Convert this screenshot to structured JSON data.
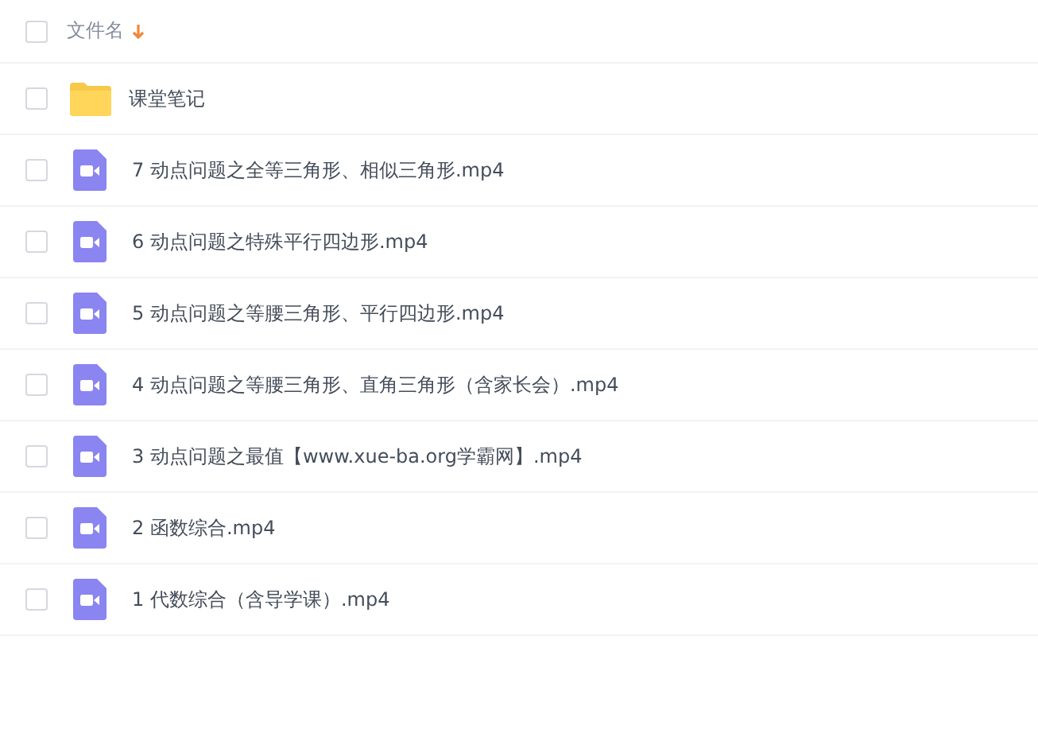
{
  "header": {
    "name_label": "文件名",
    "selected": false
  },
  "files": [
    {
      "kind": "folder",
      "name": "课堂笔记",
      "selected": false
    },
    {
      "kind": "video",
      "name": "7 动点问题之全等三角形、相似三角形.mp4",
      "selected": false
    },
    {
      "kind": "video",
      "name": "6 动点问题之特殊平行四边形.mp4",
      "selected": false
    },
    {
      "kind": "video",
      "name": "5 动点问题之等腰三角形、平行四边形.mp4",
      "selected": false
    },
    {
      "kind": "video",
      "name": "4 动点问题之等腰三角形、直角三角形（含家长会）.mp4",
      "selected": false
    },
    {
      "kind": "video",
      "name": "3 动点问题之最值【www.xue-ba.org学霸网】.mp4",
      "selected": false
    },
    {
      "kind": "video",
      "name": "2 函数综合.mp4",
      "selected": false
    },
    {
      "kind": "video",
      "name": "1 代数综合（含导学课）.mp4",
      "selected": false
    }
  ]
}
